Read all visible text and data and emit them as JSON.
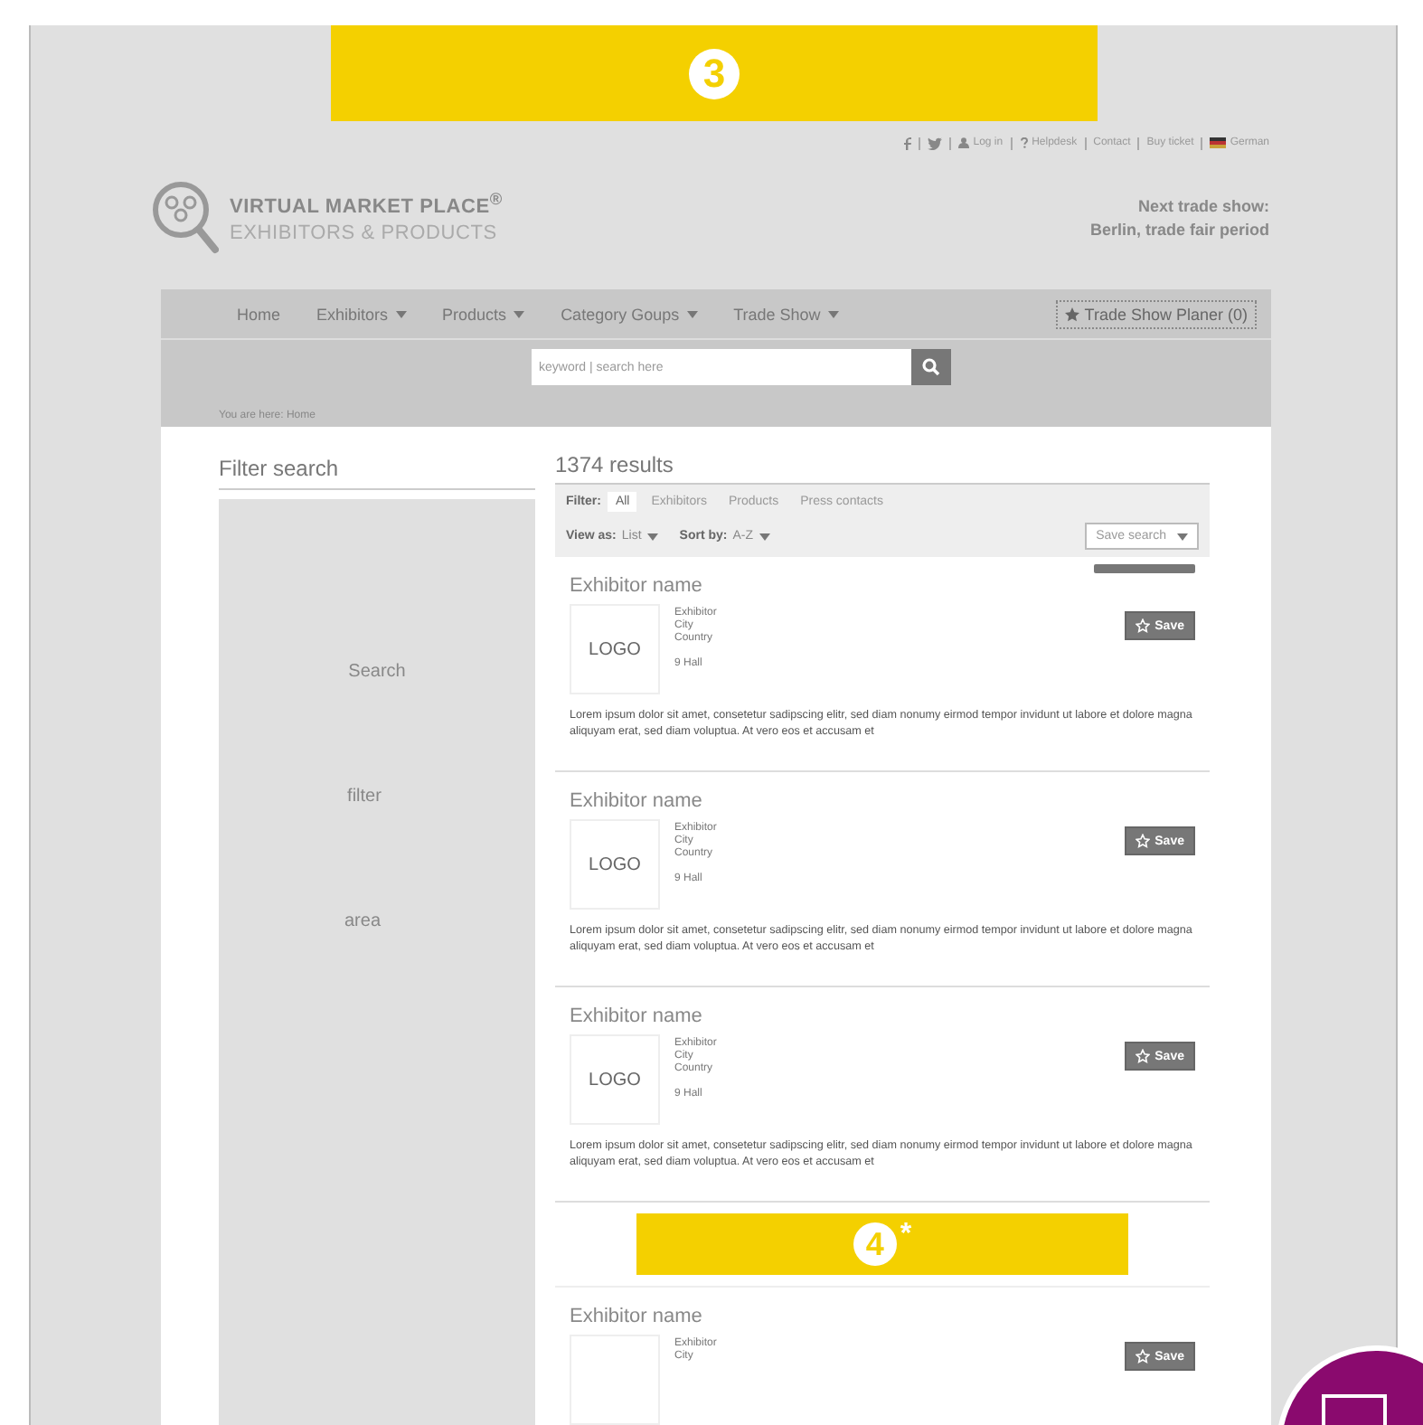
{
  "top_banner": {
    "number": "3"
  },
  "top_links": [
    {
      "kind": "facebook"
    },
    {
      "kind": "twitter"
    },
    {
      "kind": "user",
      "label": "Log in"
    },
    {
      "kind": "help",
      "label": "Helpdesk"
    },
    {
      "kind": "text",
      "label": "Contact"
    },
    {
      "kind": "text",
      "label": "Buy ticket"
    },
    {
      "kind": "flag",
      "label": "German"
    }
  ],
  "brand": {
    "title": "VIRTUAL MARKET PLACE$^{®}$",
    "subtitle": "EXHIBITORS & PRODUCTS"
  },
  "trade_show": [
    "Next trade show:",
    "Berlin, trade fair period"
  ],
  "nav": {
    "items": [
      {
        "label": "Home",
        "dropdown": false
      },
      {
        "label": "Exhibitors",
        "dropdown": true
      },
      {
        "label": "Products",
        "dropdown": true
      },
      {
        "label": "Category Goups",
        "dropdown": true
      },
      {
        "label": "Trade Show",
        "dropdown": true
      }
    ],
    "planner": "Trade Show Planer (0)"
  },
  "search": {
    "placeholder": "keyword | search here"
  },
  "breadcrumb": "You are here: Home",
  "sidebar": {
    "title": "Filter search",
    "panel_texts": [
      "Search",
      "filter",
      "area"
    ]
  },
  "results": {
    "count": "1374 results",
    "filter_label": "Filter:",
    "tabs": [
      {
        "label": "All",
        "selected": true
      },
      {
        "label": "Exhibitors",
        "selected": false
      },
      {
        "label": "Products",
        "selected": false
      },
      {
        "label": "Press contacts",
        "selected": false
      }
    ],
    "view_label": "View as:",
    "view_value": "List",
    "sort_label": "Sort by:",
    "sort_value": "A-Z",
    "save_search": "Save search",
    "items": [
      {
        "kind": "exhibitor",
        "name": "Exhibitor name",
        "premium": true,
        "logo": "LOGO",
        "lines": [
          "Exhibitor",
          "City",
          "Country"
        ],
        "hall": "9 Hall",
        "save": "Save",
        "description": "Lorem ipsum dolor sit amet, consetetur sadipscing elitr, sed diam nonumy eirmod tempor invidunt ut labore et dolore magna aliquyam erat, sed diam voluptua. At vero eos et accusam et"
      },
      {
        "kind": "exhibitor",
        "name": "Exhibitor name",
        "premium": false,
        "logo": "LOGO",
        "lines": [
          "Exhibitor",
          "City",
          "Country"
        ],
        "hall": "9 Hall",
        "save": "Save",
        "description": "Lorem ipsum dolor sit amet, consetetur sadipscing elitr, sed diam nonumy eirmod tempor invidunt ut labore et dolore magna aliquyam erat, sed diam voluptua. At vero eos et accusam et"
      },
      {
        "kind": "exhibitor",
        "name": "Exhibitor name",
        "premium": false,
        "logo": "LOGO",
        "lines": [
          "Exhibitor",
          "City",
          "Country"
        ],
        "hall": "9 Hall",
        "save": "Save",
        "description": "Lorem ipsum dolor sit amet, consetetur sadipscing elitr, sed diam nonumy eirmod tempor invidunt ut labore et dolore magna aliquyam erat, sed diam voluptua. At vero eos et accusam et"
      },
      {
        "kind": "ad",
        "number": "4",
        "mark": "*"
      },
      {
        "kind": "exhibitor",
        "name": "Exhibitor name",
        "premium": false,
        "lines": [
          "Exhibitor",
          "City"
        ],
        "save": "Save"
      }
    ]
  }
}
